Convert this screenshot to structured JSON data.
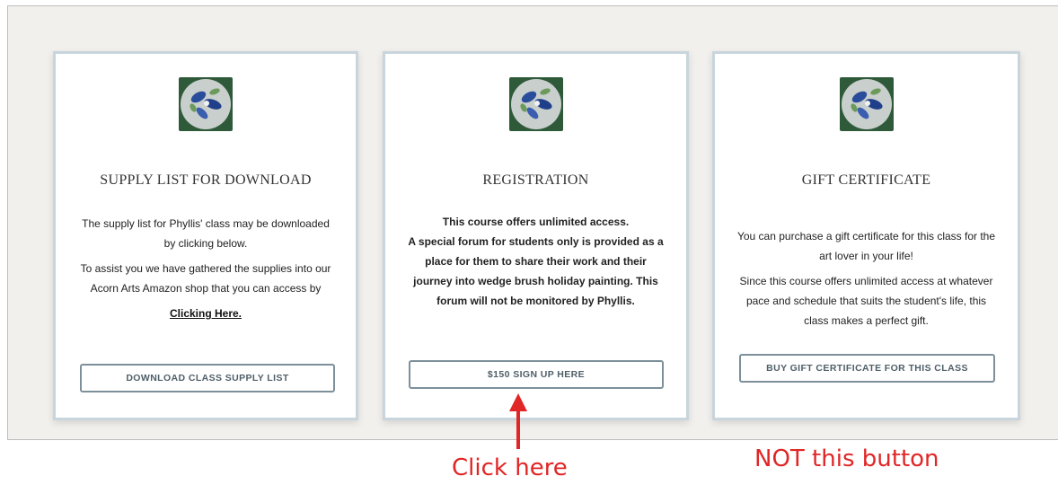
{
  "cards": [
    {
      "title": "SUPPLY LIST FOR DOWNLOAD",
      "paragraphs": [
        "The supply list for Phyllis' class may be downloaded by clicking below.",
        "To assist you we have gathered the supplies into our Acorn Arts Amazon shop that you can access by"
      ],
      "link_text": "Clicking Here.",
      "button_label": "DOWNLOAD CLASS SUPPLY LIST"
    },
    {
      "title": "REGISTRATION",
      "paragraphs": [
        "This course offers unlimited access.",
        "A special forum for students only is provided as a place for them to share their work and their journey into wedge brush holiday painting. This forum will not be monitored by Phyllis."
      ],
      "button_label": "$150 SIGN UP HERE"
    },
    {
      "title": "GIFT CERTIFICATE",
      "paragraphs": [
        "You can purchase a gift certificate for this class for the art lover in your life!",
        "Since this course offers unlimited access at whatever pace and schedule that suits the student's life, this class makes a perfect gift."
      ],
      "button_label": "BUY GIFT CERTIFICATE FOR THIS CLASS"
    }
  ],
  "annotations": {
    "click_here": "Click here",
    "not_this": "NOT this button",
    "color": "#e02626"
  },
  "colors": {
    "card_border": "#c8d5dc",
    "button_border": "#7d909a",
    "background": "#f2f0ed"
  }
}
